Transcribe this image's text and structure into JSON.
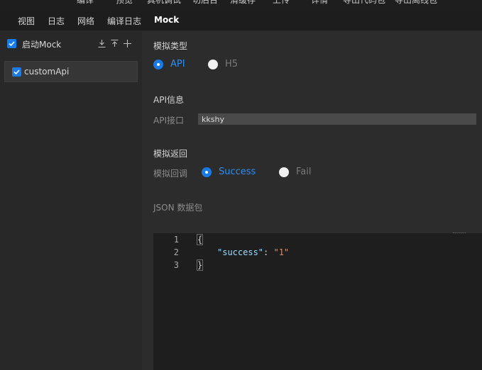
{
  "top_menu": [
    "编译",
    "预览",
    "真机调试",
    "切后台",
    "清缓存",
    "上传",
    "详情",
    "导出代码包",
    "导出离线包"
  ],
  "tabs": [
    {
      "label": "视图",
      "active": false
    },
    {
      "label": "日志",
      "active": false
    },
    {
      "label": "网络",
      "active": false
    },
    {
      "label": "编译日志",
      "active": false
    },
    {
      "label": "Mock",
      "active": true
    }
  ],
  "sidebar": {
    "enable_label": "启动Mock",
    "enable_checked": true,
    "icons": [
      "download-icon",
      "upload-icon",
      "add-icon"
    ],
    "items": [
      {
        "label": "customApi",
        "checked": true
      }
    ]
  },
  "mock": {
    "type_title": "模拟类型",
    "type_options": [
      {
        "label": "API",
        "selected": true
      },
      {
        "label": "H5",
        "selected": false
      }
    ],
    "api_info_title": "API信息",
    "api_endpoint_label": "API接口",
    "api_endpoint_value": "kkshy",
    "return_title": "模拟返回",
    "callback_label": "模拟回调",
    "callback_options": [
      {
        "label": "Success",
        "selected": true
      },
      {
        "label": "Fail",
        "selected": false
      }
    ],
    "json_label": "JSON 数据包"
  },
  "editor": {
    "line_numbers": [
      "1",
      "2",
      "3"
    ],
    "open_brace": "{",
    "key": "\"success\"",
    "colon": ": ",
    "value": "\"1\"",
    "close_brace": "}"
  },
  "colors": {
    "accent": "#1a7ae6",
    "accent_text": "#2e8ef0",
    "background": "#2c2c2c",
    "editor_bg": "#1e1e1e"
  }
}
